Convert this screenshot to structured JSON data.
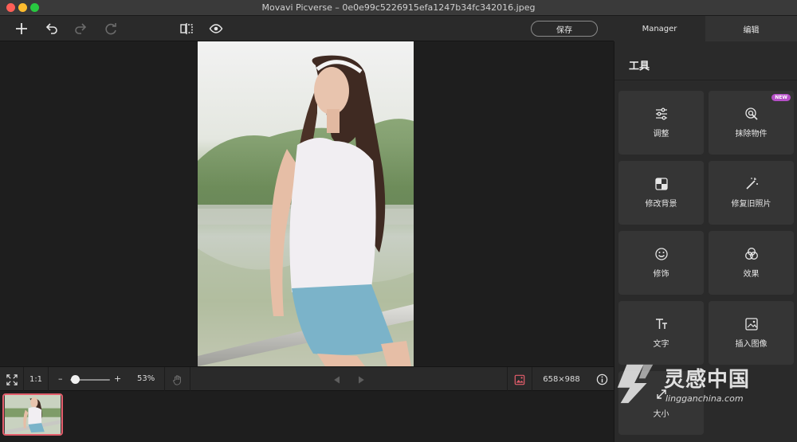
{
  "window": {
    "title": "Movavi Picverse – 0e0e99c5226915efa1247b34fc342016.jpeg"
  },
  "toolbar": {
    "save_label": "保存"
  },
  "tabs": [
    {
      "label": "Manager"
    },
    {
      "label": "编辑"
    }
  ],
  "panel": {
    "title": "工具",
    "tools": [
      {
        "label": "调整",
        "icon": "sliders-icon"
      },
      {
        "label": "抹除物件",
        "icon": "erase-object-icon",
        "badge": "NEW"
      },
      {
        "label": "修改背景",
        "icon": "background-icon"
      },
      {
        "label": "修复旧照片",
        "icon": "magic-wand-icon"
      },
      {
        "label": "修饰",
        "icon": "smile-icon"
      },
      {
        "label": "效果",
        "icon": "effects-icon"
      },
      {
        "label": "文字",
        "icon": "text-icon"
      },
      {
        "label": "插入图像",
        "icon": "insert-image-icon"
      },
      {
        "label": "大小",
        "icon": "resize-icon"
      }
    ]
  },
  "bottombar": {
    "actual_size_label": "1:1",
    "zoom_minus": "–",
    "zoom_plus": "+",
    "zoom_value": 0.53,
    "zoom_text": "53%",
    "image_size": "658×988"
  },
  "watermark": {
    "cn": "灵感中国",
    "en": "lingganchina.com"
  },
  "colors": {
    "accent": "#e25d6b",
    "new_badge": "#b64fc8"
  }
}
